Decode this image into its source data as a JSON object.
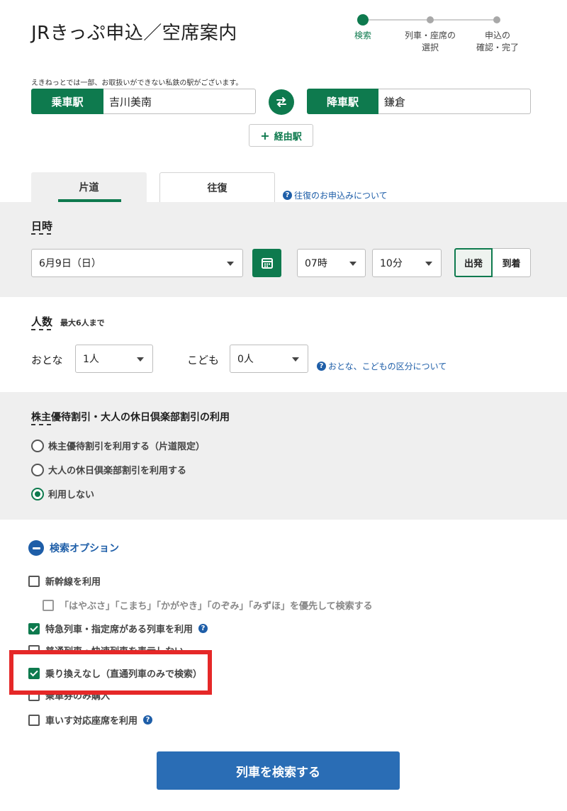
{
  "header": {
    "title": "JRきっぷ申込／空席案内",
    "steps": [
      {
        "line1": "検索",
        "line2": ""
      },
      {
        "line1": "列車・座席の",
        "line2": "選択"
      },
      {
        "line1": "申込の",
        "line2": "確認・完了"
      }
    ]
  },
  "notice": "えきねっとでは一部、お取扱いができない私鉄の駅がございます。",
  "stations": {
    "departure_label": "乗車駅",
    "departure_value": "吉川美南",
    "arrival_label": "降車駅",
    "arrival_value": "鎌倉",
    "via_label": "経由駅",
    "via_icon": "plus-icon",
    "swap_icon": "swap-arrows-icon"
  },
  "tabs": {
    "oneway": "片道",
    "roundtrip": "往復",
    "roundtrip_help": "往復のお申込みについて"
  },
  "datetime": {
    "section_title": "日時",
    "date_value": "6月9日（日）",
    "hour_value": "07時",
    "minute_value": "10分",
    "depart_label": "出発",
    "arrive_label": "到着",
    "selected": "出発"
  },
  "passengers": {
    "section_title": "人数",
    "note": "最大6人まで",
    "adult_label": "おとな",
    "adult_value": "1人",
    "child_label": "こども",
    "child_value": "0人",
    "help": "おとな、こどもの区分について"
  },
  "discount": {
    "section_title": "株主優待割引・大人の休日倶楽部割引の利用",
    "options": [
      {
        "label": "株主優待割引を利用する（片道限定）",
        "selected": false
      },
      {
        "label": "大人の休日倶楽部割引を利用する",
        "selected": false
      },
      {
        "label": "利用しない",
        "selected": true
      }
    ]
  },
  "search_options": {
    "toggle_label": "検索オプション",
    "items": [
      {
        "label": "新幹線を利用",
        "checked": false
      },
      {
        "label": "「はやぶさ」「こまち」「かがやき」「のぞみ」「みずほ」を優先して検索する",
        "checked": false
      },
      {
        "label": "特急列車・指定席がある列車を利用",
        "checked": true
      },
      {
        "label": "普通列車・快速列車を表示しない",
        "checked": false
      },
      {
        "label": "乗り換えなし（直通列車のみで検索）",
        "checked": true
      },
      {
        "label": "乗車券のみ購入",
        "checked": false
      },
      {
        "label": "車いす対応座席を利用",
        "checked": false
      }
    ]
  },
  "search_button": "列車を検索する",
  "colors": {
    "primary_green": "#0e7a4e",
    "link_blue": "#1e5ea8",
    "button_blue": "#2a6db5",
    "highlight_red": "#e52828"
  }
}
